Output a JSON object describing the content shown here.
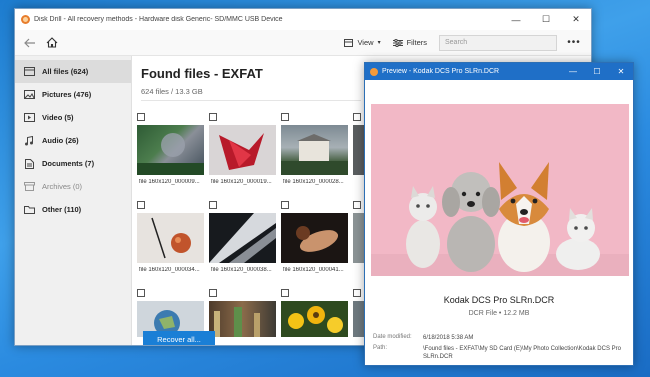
{
  "main_window": {
    "title": "Disk Drill - All recovery methods - Hardware disk Generic- SD/MMC USB Device",
    "controls": {
      "minimize": "—",
      "maximize": "☐",
      "close": "✕"
    }
  },
  "toolbar": {
    "view_label": "View",
    "filters_label": "Filters",
    "search_placeholder": "Search",
    "more_label": "•••"
  },
  "sidebar": {
    "items": [
      {
        "label": "All files (624)",
        "icon": "all-files-icon",
        "active": true
      },
      {
        "label": "Pictures (476)",
        "icon": "pictures-icon"
      },
      {
        "label": "Video (5)",
        "icon": "video-icon"
      },
      {
        "label": "Audio (26)",
        "icon": "audio-icon"
      },
      {
        "label": "Documents (7)",
        "icon": "documents-icon"
      },
      {
        "label": "Archives (0)",
        "icon": "archives-icon",
        "dim": true
      },
      {
        "label": "Other (110)",
        "icon": "other-icon"
      }
    ]
  },
  "content": {
    "title": "Found files - EXFAT",
    "subtitle": "624 files / 13.3 GB",
    "recover_label": "Recover all...",
    "files": [
      {
        "name": "file 160x120_000009..."
      },
      {
        "name": "file 160x120_000019..."
      },
      {
        "name": "file 160x120_000028..."
      },
      {
        "name": ""
      },
      {
        "name": "file 160x120_000034..."
      },
      {
        "name": "file 160x120_000038..."
      },
      {
        "name": "file 160x120_000041..."
      },
      {
        "name": ""
      },
      {
        "name": ""
      },
      {
        "name": ""
      },
      {
        "name": ""
      },
      {
        "name": ""
      }
    ]
  },
  "preview": {
    "title": "Preview - Kodak DCS Pro SLRn.DCR",
    "file_name": "Kodak DCS Pro SLRn.DCR",
    "file_meta": "DCR File • 12.2 MB",
    "date_label": "Date modified:",
    "date_value": "6/18/2018 5:38 AM",
    "path_label": "Path:",
    "path_value": "\\Found files - EXFAT\\My SD Card (E)\\My Photo Collection\\Kodak DCS Pro SLRn.DCR",
    "controls": {
      "minimize": "—",
      "maximize": "☐",
      "close": "✕"
    }
  },
  "colors": {
    "accent": "#1a7fd6",
    "preview_titlebar": "#1f6fc7",
    "preview_bg": "#f2b8c6"
  }
}
